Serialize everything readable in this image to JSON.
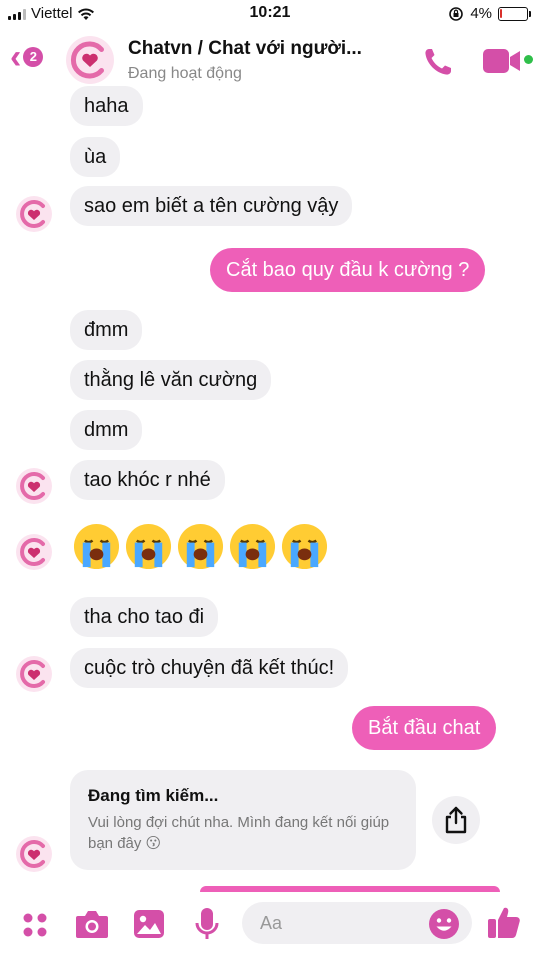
{
  "status_bar": {
    "carrier": "Viettel",
    "time": "10:21",
    "battery": "4%"
  },
  "header": {
    "back_count": "2",
    "title": "Chatvn / Chat với người...",
    "subtitle": "Đang hoạt động"
  },
  "messages": [
    {
      "text": "haha"
    },
    {
      "text": "ùa"
    },
    {
      "text": "sao em biết a tên cường vậy"
    },
    {
      "text": "Cắt bao quy đầu k cường ?"
    },
    {
      "text": "đmm"
    },
    {
      "text": "thằng lê văn cường"
    },
    {
      "text": "dmm"
    },
    {
      "text": "tao khóc r nhé"
    },
    {
      "text": "tha cho tao đi"
    },
    {
      "text": "cuộc trò chuyện đã kết thúc!"
    },
    {
      "text": "Bắt đầu chat"
    }
  ],
  "emoji_reaction": "crying-face",
  "search_card": {
    "title": "Đang tìm kiếm...",
    "body": "Vui lòng đợi chút nha. Mình đang kết nối giúp bạn đây 😗"
  },
  "composer": {
    "placeholder": "Aa"
  },
  "colors": {
    "accent": "#d44fa8",
    "outgoing_bubble": "#ee5fb8",
    "incoming_bubble": "#f0eff2",
    "online": "#2fbf4a"
  }
}
